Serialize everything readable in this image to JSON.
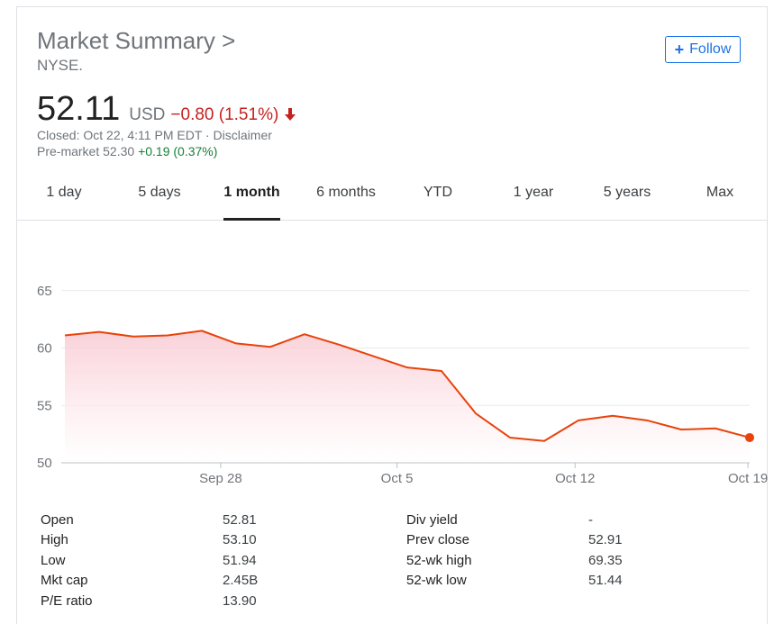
{
  "header": {
    "title": "Market Summary >",
    "exchange": "NYSE.",
    "follow_label": "Follow"
  },
  "quote": {
    "price": "52.11",
    "currency": "USD",
    "change": "−0.80 (1.51%)",
    "closed_text": "Closed: Oct 22, 4:11 PM EDT · Disclaimer",
    "premarket_label": "Pre-market 52.30",
    "premarket_change": "+0.19 (0.37%)"
  },
  "colors": {
    "negative": "#c5221f",
    "positive": "#188038",
    "line": "#e8430a",
    "fill": "#fce4e8",
    "accent": "#1a73e8"
  },
  "tabs": [
    "1 day",
    "5 days",
    "1 month",
    "6 months",
    "YTD",
    "1 year",
    "5 years",
    "Max"
  ],
  "active_tab": "1 month",
  "chart_data": {
    "type": "area",
    "x": [
      "Sep 23",
      "Sep 24",
      "Sep 25",
      "Sep 26",
      "Sep 27",
      "Sep 30",
      "Oct 1",
      "Oct 2",
      "Oct 3",
      "Oct 4",
      "Oct 7",
      "Oct 8",
      "Oct 9",
      "Oct 10",
      "Oct 11",
      "Oct 14",
      "Oct 15",
      "Oct 16",
      "Oct 17",
      "Oct 18",
      "Oct 21",
      "Oct 22"
    ],
    "values": [
      61.1,
      61.4,
      61.0,
      61.1,
      61.5,
      60.4,
      60.1,
      61.2,
      60.3,
      59.3,
      58.3,
      58.0,
      54.3,
      52.2,
      51.9,
      53.7,
      54.1,
      53.7,
      52.9,
      53.0,
      52.2
    ],
    "xticks": [
      "Sep 28",
      "Oct 5",
      "Oct 12",
      "Oct 19"
    ],
    "yticks": [
      50,
      55,
      60,
      65
    ],
    "ylim": [
      50,
      66
    ],
    "grid": true
  },
  "stats": {
    "left": [
      {
        "label": "Open",
        "value": "52.81"
      },
      {
        "label": "High",
        "value": "53.10"
      },
      {
        "label": "Low",
        "value": "51.94"
      },
      {
        "label": "Mkt cap",
        "value": "2.45B"
      },
      {
        "label": "P/E ratio",
        "value": "13.90"
      }
    ],
    "right": [
      {
        "label": "Div yield",
        "value": "-"
      },
      {
        "label": "Prev close",
        "value": "52.91"
      },
      {
        "label": "52-wk high",
        "value": "69.35"
      },
      {
        "label": "52-wk low",
        "value": "51.44"
      }
    ]
  }
}
